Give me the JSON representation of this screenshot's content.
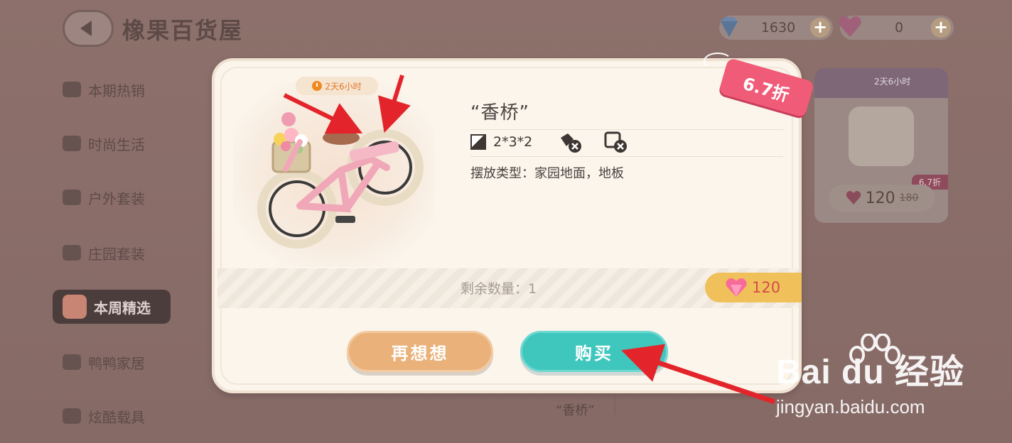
{
  "header": {
    "title": "橡果百货屋",
    "currencies": [
      {
        "icon": "blue-diamond-icon",
        "value": "1630"
      },
      {
        "icon": "pink-heart-diamond-icon",
        "value": "0"
      }
    ],
    "plus_label": "+"
  },
  "sidebar": {
    "items": [
      {
        "label": "本期热销",
        "active": false
      },
      {
        "label": "时尚生活",
        "active": false
      },
      {
        "label": "户外套装",
        "active": false
      },
      {
        "label": "庄园套装",
        "active": false
      },
      {
        "label": "本周精选",
        "active": true
      },
      {
        "label": "鸭鸭家居",
        "active": false
      },
      {
        "label": "炫酷载具",
        "active": false
      }
    ]
  },
  "background_card": {
    "timer": "2天6小时",
    "price": "120",
    "old_price": "180",
    "discount": "6.7折"
  },
  "background_label": "“香桥”",
  "modal": {
    "timer": "2天6小时",
    "discount_tag": "6.7折",
    "item_name": "“香桥”",
    "size": "2*3*2",
    "place_type": "摆放类型：家园地面，地板",
    "remaining": "剩余数量：1",
    "price": "120",
    "cancel_label": "再想想",
    "buy_label": "购买"
  },
  "watermark": {
    "brand": "Bai du 经验",
    "url": "jingyan.baidu.com"
  },
  "colors": {
    "accent_teal": "#3fc7bd",
    "cancel_orange": "#eab27a",
    "discount_pink": "#f05b78",
    "price_gold": "#f0c15a"
  }
}
